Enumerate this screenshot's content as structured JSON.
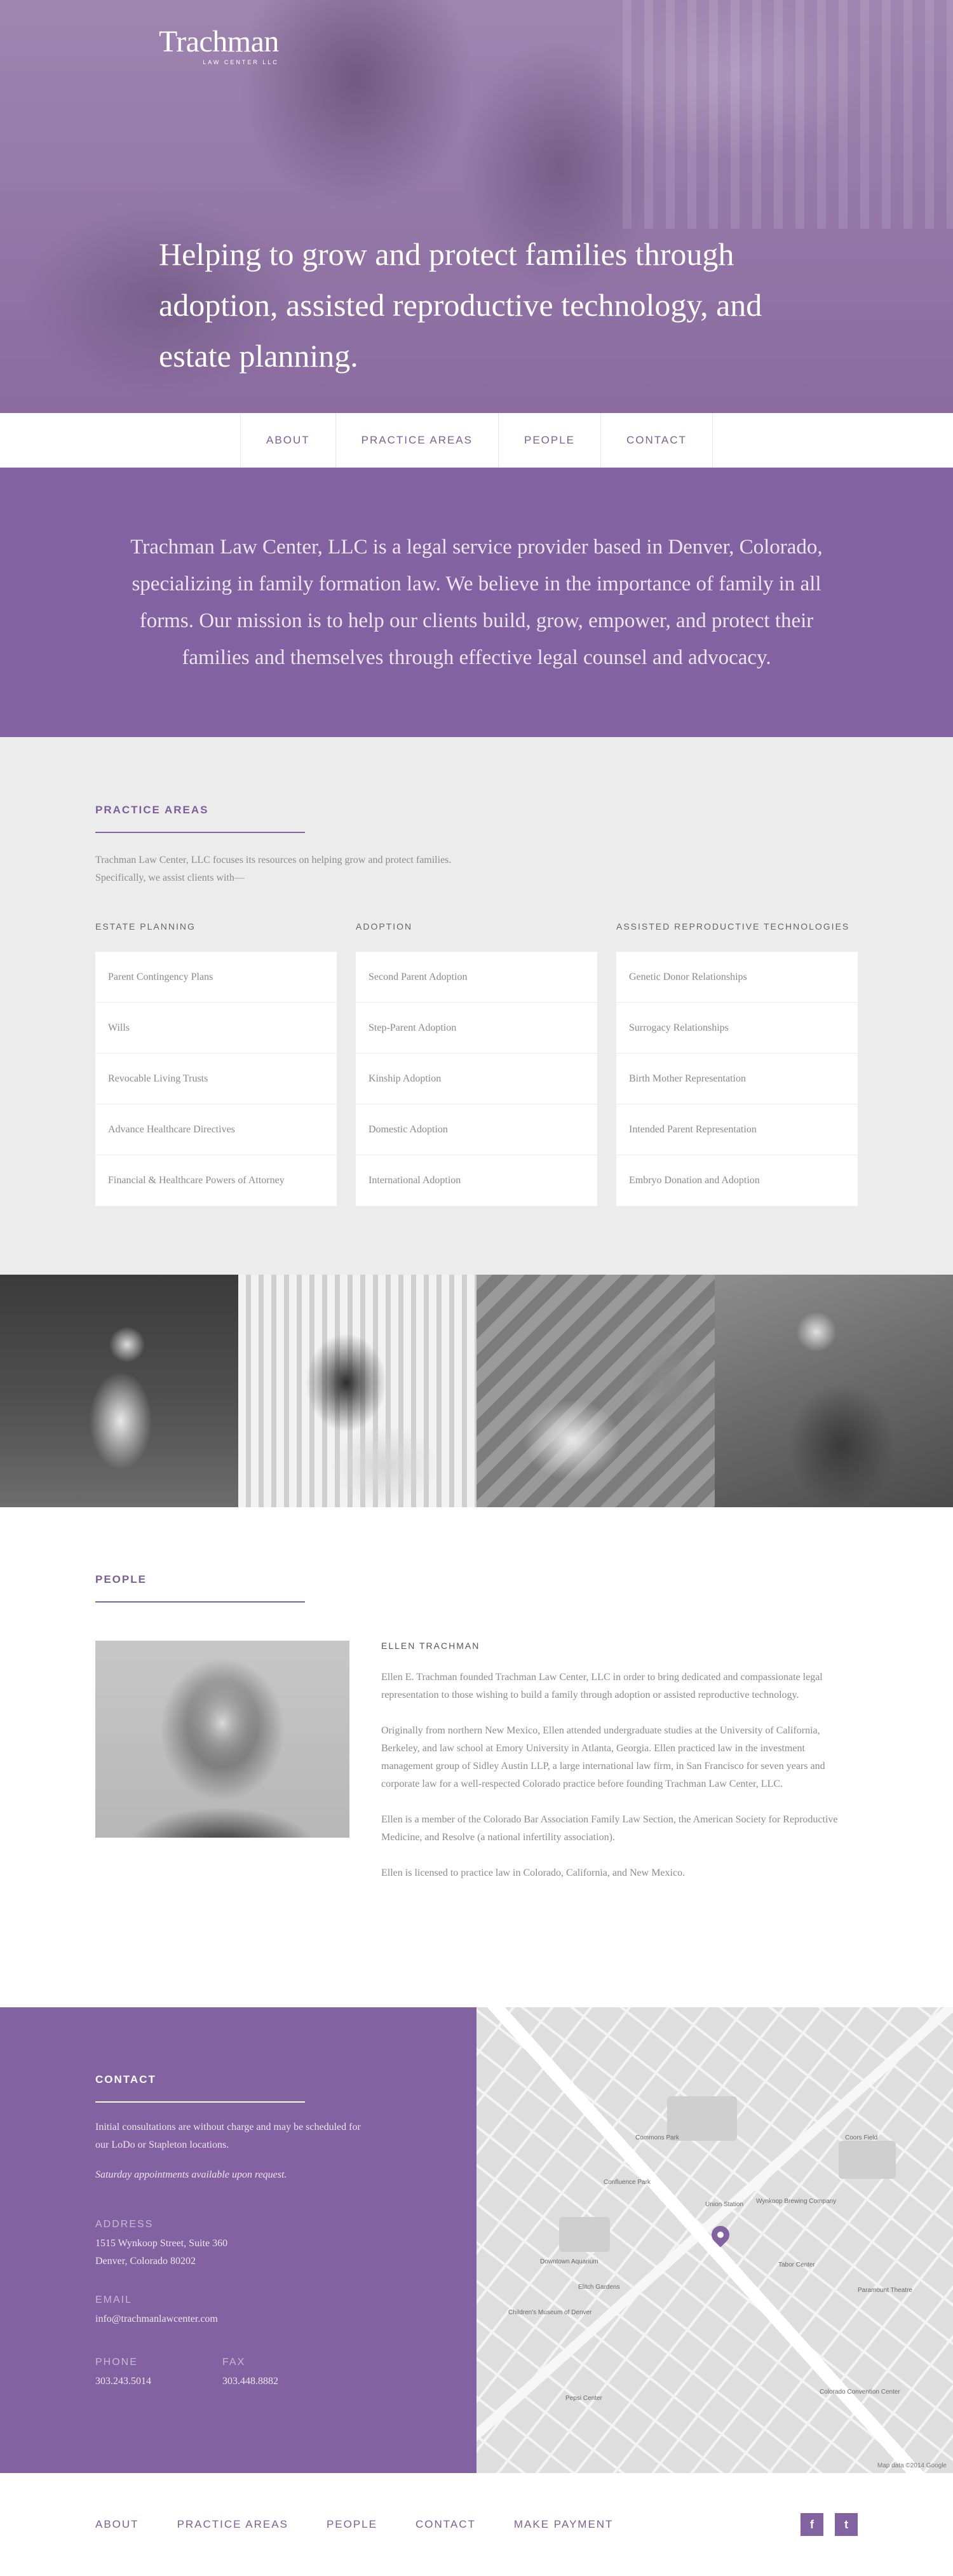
{
  "brand": {
    "name": "Trachman",
    "subtitle": "LAW CENTER LLC"
  },
  "hero": {
    "tagline": "Helping to grow and protect families through adoption, assisted reproductive technology, and estate planning."
  },
  "nav": {
    "items": [
      "ABOUT",
      "PRACTICE AREAS",
      "PEOPLE",
      "CONTACT"
    ]
  },
  "mission": {
    "text": "Trachman Law Center, LLC is a legal service provider based in Denver, Colorado, specializing in family formation law. We believe in the importance of family in all forms. Our mission is to help our clients build, grow, empower, and protect their families and themselves through effective legal counsel and advocacy."
  },
  "practice": {
    "title": "PRACTICE AREAS",
    "intro": "Trachman Law Center, LLC focuses its resources on helping grow and protect families. Specifically, we assist clients with—",
    "columns": [
      {
        "heading": "ESTATE PLANNING",
        "items": [
          "Parent Contingency Plans",
          "Wills",
          "Revocable Living Trusts",
          "Advance Healthcare Directives",
          "Financial & Healthcare Powers of Attorney"
        ]
      },
      {
        "heading": "ADOPTION",
        "items": [
          "Second Parent Adoption",
          "Step-Parent Adoption",
          "Kinship Adoption",
          "Domestic Adoption",
          "International Adoption"
        ]
      },
      {
        "heading": "ASSISTED REPRODUCTIVE TECHNOLOGIES",
        "items": [
          "Genetic Donor Relationships",
          "Surrogacy Relationships",
          "Birth Mother Representation",
          "Intended Parent Representation",
          "Embryo Donation and Adoption"
        ]
      }
    ]
  },
  "people": {
    "title": "PEOPLE",
    "name": "ELLEN TRACHMAN",
    "bio": [
      "Ellen E. Trachman founded Trachman Law Center, LLC in order to bring dedicated and compassionate legal representation to those wishing to build a family through adoption or assisted reproductive technology.",
      "Originally from northern New Mexico, Ellen attended undergraduate studies at the University of California, Berkeley, and law school at Emory University in Atlanta, Georgia. Ellen practiced law in the investment management group of Sidley Austin LLP, a large international law firm, in San Francisco for seven years and corporate law for a well-respected Colorado practice before founding Trachman Law Center, LLC.",
      "Ellen is a member of the Colorado Bar Association Family Law Section, the American Society for Reproductive Medicine, and Resolve (a national infertility association).",
      "Ellen is licensed to practice law in Colorado, California, and New Mexico."
    ]
  },
  "contact": {
    "title": "CONTACT",
    "intro": "Initial consultations are without charge and may be scheduled for our LoDo or Stapleton locations.",
    "saturday": "Saturday appointments available upon request.",
    "address_label": "ADDRESS",
    "address_line1": "1515 Wynkoop Street, Suite 360",
    "address_line2": "Denver, Colorado 80202",
    "email_label": "EMAIL",
    "email": "info@trachmanlawcenter.com",
    "phone_label": "PHONE",
    "phone": "303.243.5014",
    "fax_label": "FAX",
    "fax": "303.448.8882"
  },
  "map": {
    "labels": [
      "Commons Park",
      "Confluence Park",
      "Downtown Aquarium",
      "Elitch Gardens",
      "Coors Field",
      "Union Station",
      "Tabor Center",
      "Children's Museum of Denver",
      "Pepsi Center",
      "Wynkoop Brewing Company",
      "Paramount Theatre",
      "Colorado Convention Center"
    ],
    "attribution": "Map data ©2014 Google"
  },
  "footer": {
    "links": [
      "ABOUT",
      "PRACTICE AREAS",
      "PEOPLE",
      "CONTACT",
      "MAKE PAYMENT"
    ],
    "facebook": "f",
    "twitter": "t"
  }
}
